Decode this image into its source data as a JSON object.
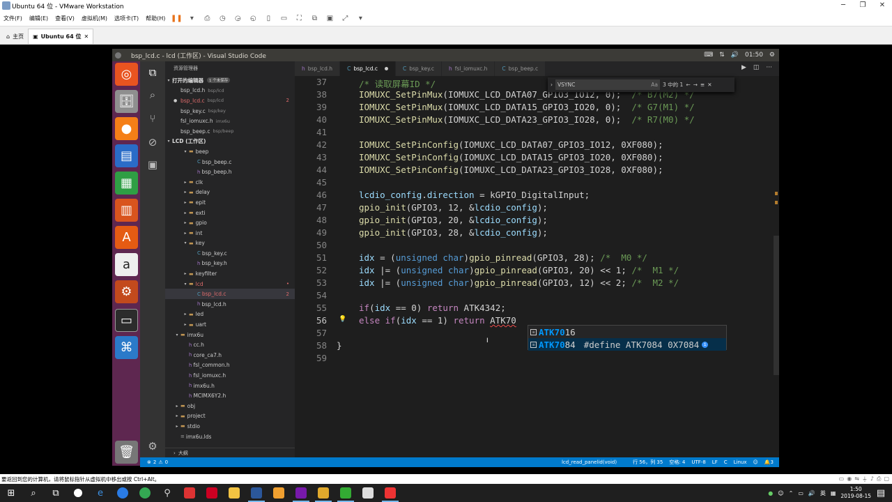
{
  "vmware": {
    "title": "Ubuntu 64 位 - VMware Workstation",
    "menu": [
      "文件(F)",
      "编辑(E)",
      "查看(V)",
      "虚拟机(M)",
      "选项卡(T)",
      "帮助(H)"
    ],
    "tabs": [
      {
        "label": "主页"
      },
      {
        "label": "Ubuntu 64 位"
      }
    ],
    "hint": "要返回到您的计算机，请将鼠标指针从虚拟机中移出或按 Ctrl+Alt。"
  },
  "ubuntu": {
    "window_title": "bsp_lcd.c - lcd (工作区) - Visual Studio Code",
    "clock": "01:50"
  },
  "sidebar": {
    "header": "资源管理器",
    "open_editors": "打开的编辑器",
    "unsaved": "1 个未保存",
    "open_files": [
      {
        "name": "bsp_lcd.h",
        "path": "bsp/lcd"
      },
      {
        "name": "bsp_lcd.c",
        "path": "bsp/lcd",
        "badge": "2"
      },
      {
        "name": "bsp_key.c",
        "path": "bsp/key"
      },
      {
        "name": "fsl_iomuxc.h",
        "path": "imx6u"
      },
      {
        "name": "bsp_beep.c",
        "path": "bsp/beep"
      }
    ],
    "workspace": "LCD (工作区)",
    "tree": [
      {
        "name": "beep",
        "d": 1,
        "t": "open"
      },
      {
        "name": "bsp_beep.c",
        "d": 2,
        "t": "c"
      },
      {
        "name": "bsp_beep.h",
        "d": 2,
        "t": "h"
      },
      {
        "name": "clk",
        "d": 1,
        "t": "closed"
      },
      {
        "name": "delay",
        "d": 1,
        "t": "closed"
      },
      {
        "name": "epit",
        "d": 1,
        "t": "closed"
      },
      {
        "name": "exti",
        "d": 1,
        "t": "closed"
      },
      {
        "name": "gpio",
        "d": 1,
        "t": "closed"
      },
      {
        "name": "int",
        "d": 1,
        "t": "closed"
      },
      {
        "name": "key",
        "d": 1,
        "t": "open"
      },
      {
        "name": "bsp_key.c",
        "d": 2,
        "t": "c"
      },
      {
        "name": "bsp_key.h",
        "d": 2,
        "t": "h"
      },
      {
        "name": "keyfilter",
        "d": 1,
        "t": "closed"
      },
      {
        "name": "lcd",
        "d": 1,
        "t": "open",
        "mark": "•"
      },
      {
        "name": "bsp_lcd.c",
        "d": 2,
        "t": "c",
        "sel": true,
        "badge": "2"
      },
      {
        "name": "bsp_lcd.h",
        "d": 2,
        "t": "h"
      },
      {
        "name": "led",
        "d": 1,
        "t": "closed"
      },
      {
        "name": "uart",
        "d": 1,
        "t": "closed"
      },
      {
        "name": "imx6u",
        "d": 0,
        "t": "open"
      },
      {
        "name": "cc.h",
        "d": 1,
        "t": "h"
      },
      {
        "name": "core_ca7.h",
        "d": 1,
        "t": "h"
      },
      {
        "name": "fsl_common.h",
        "d": 1,
        "t": "h"
      },
      {
        "name": "fsl_iomuxc.h",
        "d": 1,
        "t": "h"
      },
      {
        "name": "imx6u.h",
        "d": 1,
        "t": "h"
      },
      {
        "name": "MCIMX6Y2.h",
        "d": 1,
        "t": "h"
      },
      {
        "name": "obj",
        "d": 0,
        "t": "closed"
      },
      {
        "name": "project",
        "d": 0,
        "t": "closed"
      },
      {
        "name": "stdio",
        "d": 0,
        "t": "closed"
      },
      {
        "name": "imx6u.lds",
        "d": 0,
        "t": "f"
      }
    ],
    "outline": "大纲"
  },
  "editor": {
    "tabs": [
      {
        "label": "bsp_lcd.h",
        "icon": "h"
      },
      {
        "label": "bsp_lcd.c",
        "icon": "C",
        "active": true,
        "dirty": true
      },
      {
        "label": "bsp_key.c",
        "icon": "C"
      },
      {
        "label": "fsl_iomuxc.h",
        "icon": "h"
      },
      {
        "label": "bsp_beep.c",
        "icon": "C"
      }
    ],
    "find": {
      "query": "VSYNC",
      "aa": "Aa",
      "result": "3 中的 1"
    },
    "lines": [
      {
        "n": "37",
        "parts": [
          [
            "cm",
            "/* 读取屏幕ID */"
          ]
        ]
      },
      {
        "n": "38",
        "parts": [
          [
            "fn",
            "IOMUXC_SetPinMux"
          ],
          [
            "",
            "(IOMUXC_LCD_DATA07_GPIO3_IO12, 0);  "
          ],
          [
            "cm",
            "/* B7(M2) */"
          ]
        ]
      },
      {
        "n": "39",
        "parts": [
          [
            "fn",
            "IOMUXC_SetPinMux"
          ],
          [
            "",
            "(IOMUXC_LCD_DATA15_GPIO3_IO20, 0);  "
          ],
          [
            "cm",
            "/* G7(M1) */"
          ]
        ]
      },
      {
        "n": "40",
        "parts": [
          [
            "fn",
            "IOMUXC_SetPinMux"
          ],
          [
            "",
            "(IOMUXC_LCD_DATA23_GPIO3_IO28, 0);  "
          ],
          [
            "cm",
            "/* R7(M0) */"
          ]
        ]
      },
      {
        "n": "41",
        "parts": []
      },
      {
        "n": "42",
        "parts": [
          [
            "fn",
            "IOMUXC_SetPinConfig"
          ],
          [
            "",
            "(IOMUXC_LCD_DATA07_GPIO3_IO12, 0XF080);"
          ]
        ]
      },
      {
        "n": "43",
        "parts": [
          [
            "fn",
            "IOMUXC_SetPinConfig"
          ],
          [
            "",
            "(IOMUXC_LCD_DATA15_GPIO3_IO20, 0XF080);"
          ]
        ]
      },
      {
        "n": "44",
        "parts": [
          [
            "fn",
            "IOMUXC_SetPinConfig"
          ],
          [
            "",
            "(IOMUXC_LCD_DATA23_GPIO3_IO28, 0XF080);"
          ]
        ]
      },
      {
        "n": "45",
        "parts": []
      },
      {
        "n": "46",
        "parts": [
          [
            "vr",
            "lcdio_config"
          ],
          [
            "",
            "."
          ],
          [
            "vr",
            "direction"
          ],
          [
            "",
            " = kGPIO_DigitalInput;"
          ]
        ]
      },
      {
        "n": "47",
        "parts": [
          [
            "fn",
            "gpio_init"
          ],
          [
            "",
            "(GPIO3, 12, &"
          ],
          [
            "vr",
            "lcdio_config"
          ],
          [
            "",
            ");"
          ]
        ]
      },
      {
        "n": "48",
        "parts": [
          [
            "fn",
            "gpio_init"
          ],
          [
            "",
            "(GPIO3, 20, &"
          ],
          [
            "vr",
            "lcdio_config"
          ],
          [
            "",
            ");"
          ]
        ]
      },
      {
        "n": "49",
        "parts": [
          [
            "fn",
            "gpio_init"
          ],
          [
            "",
            "(GPIO3, 28, &"
          ],
          [
            "vr",
            "lcdio_config"
          ],
          [
            "",
            ");"
          ]
        ]
      },
      {
        "n": "50",
        "parts": []
      },
      {
        "n": "51",
        "parts": [
          [
            "vr",
            "idx"
          ],
          [
            "",
            " = ("
          ],
          [
            "kw",
            "unsigned char"
          ],
          [
            "",
            ")"
          ],
          [
            "fn",
            "gpio_pinread"
          ],
          [
            "",
            "(GPIO3, 28); "
          ],
          [
            "cm",
            "/*  M0 */"
          ]
        ]
      },
      {
        "n": "52",
        "parts": [
          [
            "vr",
            "idx"
          ],
          [
            "",
            " |= ("
          ],
          [
            "kw",
            "unsigned char"
          ],
          [
            "",
            ")"
          ],
          [
            "fn",
            "gpio_pinread"
          ],
          [
            "",
            "(GPIO3, 20) << 1; "
          ],
          [
            "cm",
            "/*  M1 */"
          ]
        ]
      },
      {
        "n": "53",
        "parts": [
          [
            "vr",
            "idx"
          ],
          [
            "",
            " |= ("
          ],
          [
            "kw",
            "unsigned char"
          ],
          [
            "",
            ")"
          ],
          [
            "fn",
            "gpio_pinread"
          ],
          [
            "",
            "(GPIO3, 12) << 2; "
          ],
          [
            "cm",
            "/*  M2 */"
          ]
        ]
      },
      {
        "n": "54",
        "parts": []
      },
      {
        "n": "55",
        "parts": [
          [
            "mc",
            "if"
          ],
          [
            "",
            "("
          ],
          [
            "vr",
            "idx"
          ],
          [
            "",
            " == 0) "
          ],
          [
            "mc",
            "return"
          ],
          [
            "",
            " ATK4342;"
          ]
        ]
      },
      {
        "n": "56",
        "parts": [
          [
            "mc",
            "else if"
          ],
          [
            "",
            "("
          ],
          [
            "vr",
            "idx"
          ],
          [
            "",
            " == 1) "
          ],
          [
            "mc",
            "return"
          ],
          [
            "",
            " "
          ],
          [
            "squig",
            "ATK70"
          ]
        ]
      },
      {
        "n": "57",
        "parts": []
      },
      {
        "n": "58",
        "parts": [
          [
            "",
            "}"
          ]
        ]
      },
      {
        "n": "59",
        "parts": []
      }
    ],
    "suggest": [
      {
        "match": "ATK70",
        "rest": "16",
        "detail": ""
      },
      {
        "match": "ATK70",
        "rest": "84",
        "detail": "#define ATK7084 0X7084"
      }
    ]
  },
  "status": {
    "errors": "2",
    "warnings": "0",
    "function": "lcd_read_panelid(void)",
    "position": "行 56，列 35",
    "spaces": "空格: 4",
    "encoding": "UTF-8",
    "eol": "LF",
    "lang": "C",
    "os": "Linux",
    "notifications": "3"
  },
  "taskbar": {
    "lang": "英",
    "time": "1:50",
    "date": "2019-08-15"
  }
}
